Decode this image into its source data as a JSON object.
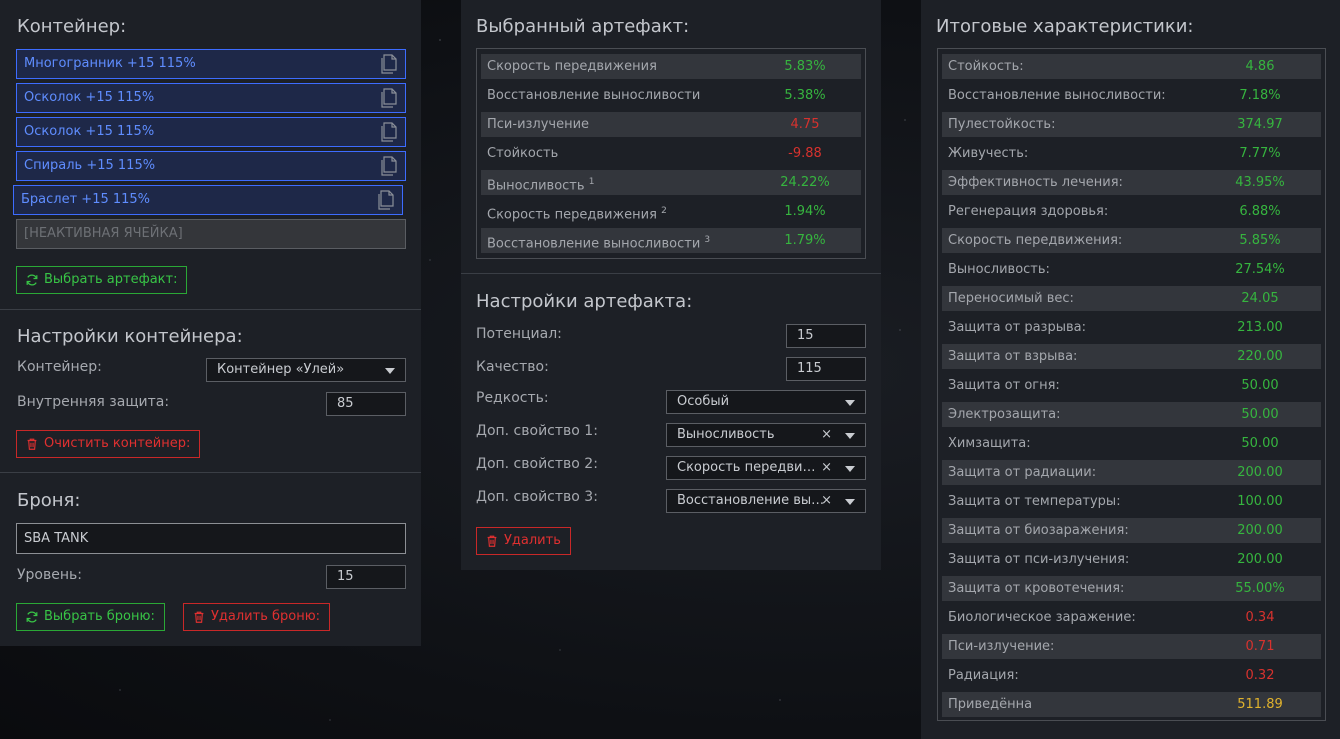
{
  "colors": {
    "positive": "#36b53f",
    "negative": "#d7322e",
    "accent": "#3d6cff",
    "highlight": "#e0b22d"
  },
  "left": {
    "container_title": "Контейнер:",
    "slots": [
      {
        "label": "Многогранник +15 115%",
        "icon": "copy-icon"
      },
      {
        "label": "Осколок +15 115%",
        "icon": "copy-icon"
      },
      {
        "label": "Осколок +15 115%",
        "icon": "copy-icon"
      },
      {
        "label": "Спираль +15 115%",
        "icon": "copy-icon"
      },
      {
        "label": "Браслет +15 115%",
        "icon": "copy-icon"
      }
    ],
    "inactive_slot": "[НЕАКТИВНАЯ ЯЧЕЙКА]",
    "choose_artifact": "Выбрать артефакт:",
    "container_settings_title": "Настройки контейнера:",
    "container_label": "Контейнер:",
    "container_value": "Контейнер «Улей»",
    "inner_protection_label": "Внутренняя защита:",
    "inner_protection_value": "85",
    "clear_container": "Очистить контейнер:",
    "armor_title": "Броня:",
    "armor_value": "SBA TANK",
    "level_label": "Уровень:",
    "level_value": "15",
    "choose_armor": "Выбрать броню:",
    "delete_armor": "Удалить броню:"
  },
  "middle": {
    "selected_title": "Выбранный артефакт:",
    "stats": [
      {
        "name": "Скорость передвижения",
        "sup": "",
        "value": "5.83%",
        "sign": "pos"
      },
      {
        "name": "Восстановление выносливости",
        "sup": "",
        "value": "5.38%",
        "sign": "pos"
      },
      {
        "name": "Пси-излучение",
        "sup": "",
        "value": "4.75",
        "sign": "neg"
      },
      {
        "name": "Стойкость",
        "sup": "",
        "value": "-9.88",
        "sign": "neg"
      },
      {
        "name": "Выносливость",
        "sup": "1",
        "value": "24.22%",
        "sign": "pos"
      },
      {
        "name": "Скорость передвижения",
        "sup": "2",
        "value": "1.94%",
        "sign": "pos"
      },
      {
        "name": "Восстановление выносливости",
        "sup": "3",
        "value": "1.79%",
        "sign": "pos"
      }
    ],
    "settings_title": "Настройки артефакта:",
    "potential_label": "Потенциал:",
    "potential_value": "15",
    "quality_label": "Качество:",
    "quality_value": "115",
    "rarity_label": "Редкость:",
    "rarity_value": "Особый",
    "extra1_label": "Доп. свойство 1:",
    "extra1_value": "Выносливость",
    "extra2_label": "Доп. свойство 2:",
    "extra2_value": "Скорость передвижения",
    "extra3_label": "Доп. свойство 3:",
    "extra3_value": "Восстановление выносливости",
    "delete": "Удалить"
  },
  "right": {
    "title": "Итоговые характеристики:",
    "stats": [
      {
        "name": "Стойкость:",
        "value": "4.86",
        "sign": "pos"
      },
      {
        "name": "Восстановление выносливости:",
        "value": "7.18%",
        "sign": "pos"
      },
      {
        "name": "Пулестойкость:",
        "value": "374.97",
        "sign": "pos"
      },
      {
        "name": "Живучесть:",
        "value": "7.77%",
        "sign": "pos"
      },
      {
        "name": "Эффективность лечения:",
        "value": "43.95%",
        "sign": "pos"
      },
      {
        "name": "Регенерация здоровья:",
        "value": "6.88%",
        "sign": "pos"
      },
      {
        "name": "Скорость передвижения:",
        "value": "5.85%",
        "sign": "pos"
      },
      {
        "name": "Выносливость:",
        "value": "27.54%",
        "sign": "pos"
      },
      {
        "name": "Переносимый вес:",
        "value": "24.05",
        "sign": "pos"
      },
      {
        "name": "Защита от разрыва:",
        "value": "213.00",
        "sign": "pos"
      },
      {
        "name": "Защита от взрыва:",
        "value": "220.00",
        "sign": "pos"
      },
      {
        "name": "Защита от огня:",
        "value": "50.00",
        "sign": "pos"
      },
      {
        "name": "Электрозащита:",
        "value": "50.00",
        "sign": "pos"
      },
      {
        "name": "Химзащита:",
        "value": "50.00",
        "sign": "pos"
      },
      {
        "name": "Защита от радиации:",
        "value": "200.00",
        "sign": "pos"
      },
      {
        "name": "Защита от температуры:",
        "value": "100.00",
        "sign": "pos"
      },
      {
        "name": "Защита от биозаражения:",
        "value": "200.00",
        "sign": "pos"
      },
      {
        "name": "Защита от пси-излучения:",
        "value": "200.00",
        "sign": "pos"
      },
      {
        "name": "Защита от кровотечения:",
        "value": "55.00%",
        "sign": "pos"
      },
      {
        "name": "Биологическое заражение:",
        "value": "0.34",
        "sign": "neg"
      },
      {
        "name": "Пси-излучение:",
        "value": "0.71",
        "sign": "neg"
      },
      {
        "name": "Радиация:",
        "value": "0.32",
        "sign": "neg"
      },
      {
        "name": "Приведённа",
        "value": "511.89",
        "sign": "gold"
      }
    ]
  }
}
